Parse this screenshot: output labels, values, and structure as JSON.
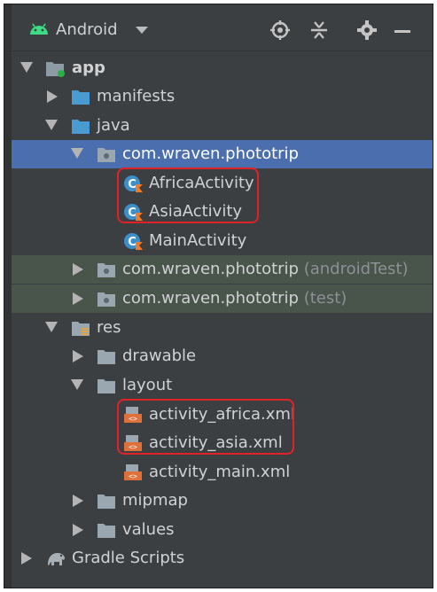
{
  "header": {
    "title": "Android",
    "icons": [
      "android-icon",
      "dropdown-caret",
      "locate-icon",
      "collapse-icon",
      "settings-icon",
      "minimize-icon"
    ]
  },
  "tree": {
    "app": "app",
    "manifests": "manifests",
    "java": "java",
    "pkg_main": "com.wraven.phototrip",
    "africa_activity": "AfricaActivity",
    "asia_activity": "AsiaActivity",
    "main_activity": "MainActivity",
    "pkg_android_test": "com.wraven.phototrip",
    "pkg_android_test_suffix": "(androidTest)",
    "pkg_test": "com.wraven.phototrip",
    "pkg_test_suffix": "(test)",
    "res": "res",
    "drawable": "drawable",
    "layout": "layout",
    "activity_africa": "activity_africa.xml",
    "activity_asia": "activity_asia.xml",
    "activity_main": "activity_main.xml",
    "mipmap": "mipmap",
    "values": "values",
    "gradle_scripts": "Gradle Scripts"
  },
  "colors": {
    "panel_bg": "#3c3f41",
    "selection": "#4b6eaf",
    "test_bg": "#49544a",
    "highlight_box": "#e0212a"
  }
}
